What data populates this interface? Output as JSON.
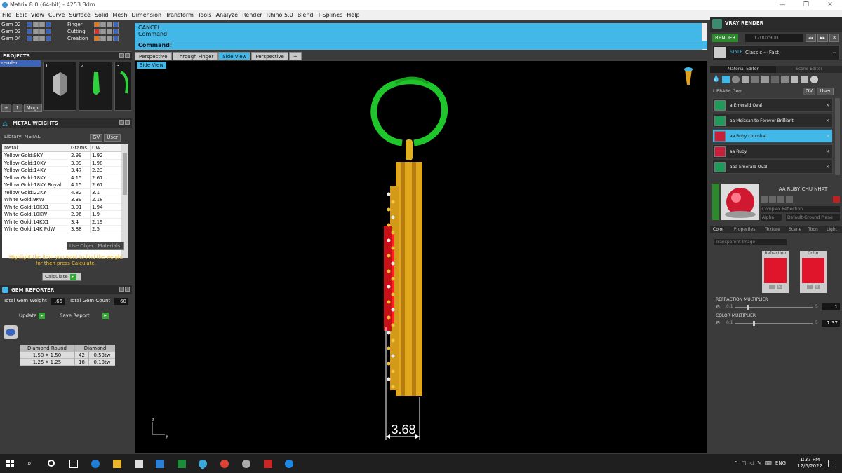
{
  "window": {
    "title": "Matrix 8.0 (64-bit) - 4253.3dm",
    "controls": [
      "—",
      "❐",
      "✕"
    ]
  },
  "menu": [
    "File",
    "Edit",
    "View",
    "Curve",
    "Surface",
    "Solid",
    "Mesh",
    "Dimension",
    "Transform",
    "Tools",
    "Analyze",
    "Render",
    "Rhino 5.0",
    "Blend",
    "T-Splines",
    "Help"
  ],
  "layers": {
    "left": [
      {
        "label": "Gem 02",
        "color": "#3c65b9"
      },
      {
        "label": "Gem 03",
        "color": "#3c65b9"
      },
      {
        "label": "Gem 04",
        "color": "#3c65b9"
      }
    ],
    "right": [
      {
        "label": "Finger",
        "color": "#e07820"
      },
      {
        "label": "Cutting",
        "color": "#d03030"
      },
      {
        "label": "Creation",
        "color": "#e07820"
      }
    ]
  },
  "projects": {
    "title": "PROJECTS",
    "tree_item": "render",
    "thumb_numbers": [
      "1",
      "2",
      "3"
    ],
    "mngr_label": "Mngr"
  },
  "metal_weights": {
    "title": "METAL WEIGHTS",
    "library_label": "Library: METAL",
    "tags": [
      "GV",
      "User"
    ],
    "headers": [
      "Metal",
      "Grams",
      "DWT"
    ],
    "rows": [
      [
        "Yellow Gold:9KY",
        "2.99",
        "1.92"
      ],
      [
        "Yellow Gold:10KY",
        "3.09",
        "1.98"
      ],
      [
        "Yellow Gold:14KY",
        "3.47",
        "2.23"
      ],
      [
        "Yellow Gold:18KY",
        "4.15",
        "2.67"
      ],
      [
        "Yellow Gold:18KY Royal",
        "4.15",
        "2.67"
      ],
      [
        "Yellow Gold:22KY",
        "4.82",
        "3.1"
      ],
      [
        "White Gold:9KW",
        "3.39",
        "2.18"
      ],
      [
        "White Gold:10KX1",
        "3.01",
        "1.94"
      ],
      [
        "White Gold:10KW",
        "2.96",
        "1.9"
      ],
      [
        "White Gold:14KX1",
        "3.4",
        "2.19"
      ],
      [
        "White Gold:14K PdW",
        "3.88",
        "2.5"
      ]
    ],
    "use_object_materials": "Use Object Materials",
    "hint": "Highlight the item you want to find the weight for then press Calculate.",
    "calculate": "Calculate"
  },
  "gem_reporter": {
    "title": "GEM REPORTER",
    "total_weight_label": "Total Gem Weight",
    "total_weight": ".66",
    "total_count_label": "Total Gem Count",
    "total_count": "60",
    "update": "Update",
    "save_report": "Save Report",
    "headers": [
      "Diamond Round",
      "Diamond"
    ],
    "rows": [
      [
        "1.50 X 1.50",
        "42",
        "0.53tw"
      ],
      [
        "1.25 X 1.25",
        "18",
        "0.13tw"
      ]
    ]
  },
  "command": {
    "line1": "CANCEL",
    "line2": "Command:",
    "prompt": "Command:"
  },
  "viewport_tabs": [
    "Perspective",
    "Through Finger",
    "Side View",
    "Perspective",
    "+"
  ],
  "active_tab_index": 2,
  "viewport": {
    "label": "Side View",
    "dimension": "3.68",
    "axis_z": "z",
    "axis_y": "y"
  },
  "vray": {
    "title": "VRAY RENDER",
    "render": "RENDER",
    "resolution": "1200x900",
    "style_label": "STYLE",
    "style_value": "Classic - (Fast)",
    "tabs": [
      "Material Editor",
      "Scene Editor"
    ],
    "library_label": "LIBRARY: Gem",
    "tags": [
      "GV",
      "User"
    ],
    "library": [
      {
        "name": "a Emerald Oval",
        "color": "#1f9a5a",
        "selected": false
      },
      {
        "name": "aa Moissanite Forever Brilliant",
        "color": "#1f9a5a",
        "selected": false
      },
      {
        "name": "aa Ruby chu nhat",
        "color": "#c8203a",
        "selected": true
      },
      {
        "name": "aa Ruby",
        "color": "#c8203a",
        "selected": false
      },
      {
        "name": "aaa Emerald Oval",
        "color": "#1f9a5a",
        "selected": false
      }
    ],
    "material_name": "AA RUBY CHU NHAT",
    "material_type": "Complex Reflection",
    "alpha_label": "Alpha",
    "ground": "Default-Ground Plane",
    "prop_tabs": [
      "Color",
      "Properties",
      "Texture",
      "Scene",
      "Toon",
      "Light"
    ],
    "transparent": "Transparent Image",
    "refraction_label": "Refraction",
    "color_label": "Color",
    "refraction_mult_label": "REFRACTION MULTIPLIER",
    "refraction_min": "0.1",
    "refraction_max": "5",
    "refraction_value": "1",
    "color_mult_label": "COLOR MULTIPLIER",
    "color_min": "0.1",
    "color_max": "5",
    "color_value": "1.37"
  },
  "taskbar": {
    "lang": "ENG",
    "time": "1:37 PM",
    "date": "12/6/2022"
  }
}
